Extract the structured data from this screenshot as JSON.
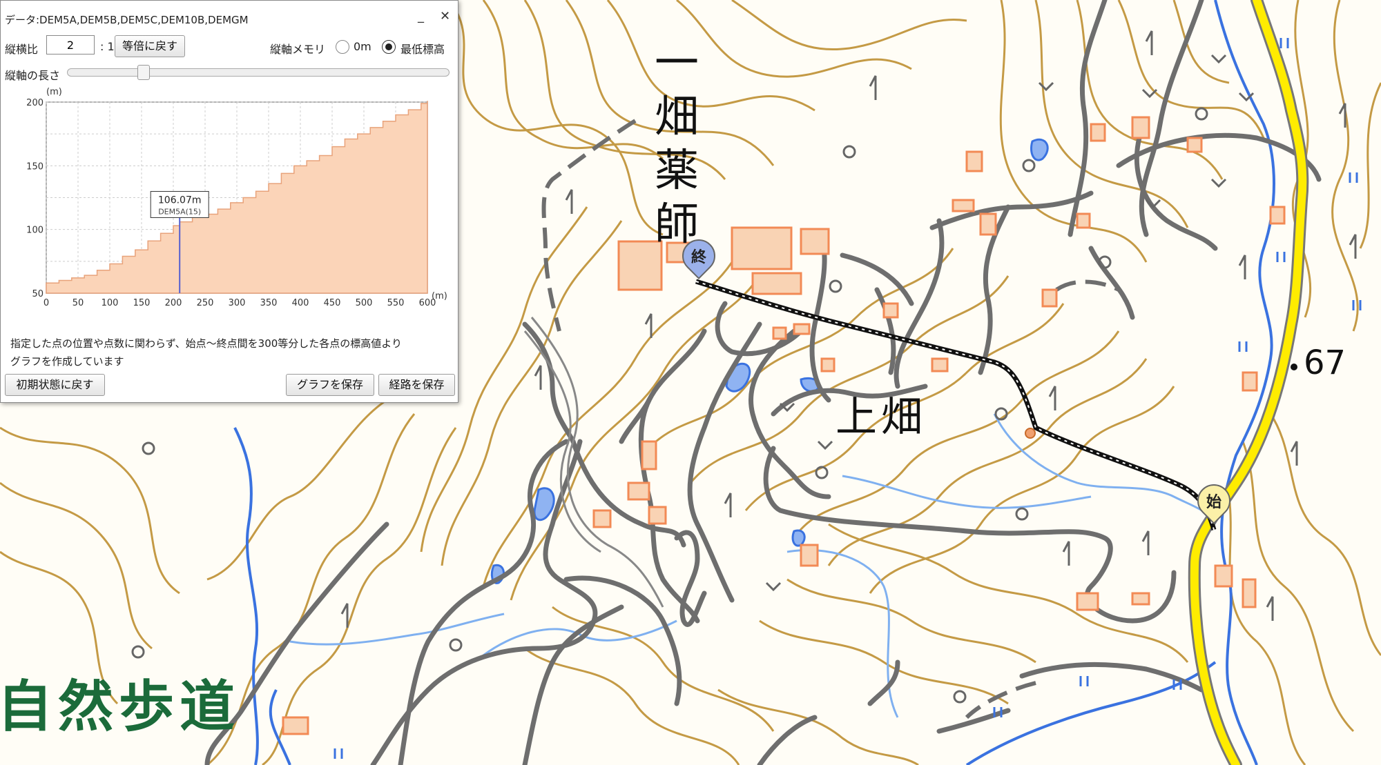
{
  "map": {
    "labels": {
      "ichihata_yakushi": [
        "一",
        "畑",
        "薬",
        "師"
      ],
      "kamihata": "上畑",
      "route_number": "67",
      "nature_trail": "自然歩道"
    },
    "markers": {
      "end": "終",
      "start": "始"
    },
    "colors": {
      "contour": "#c49a45",
      "road": "#6e6e6e",
      "river": "#3a72e0",
      "route_highlight": "#ffec00",
      "building": "#f28a55",
      "profile_path": "#111111"
    }
  },
  "panel": {
    "title": "データ:DEM5A,DEM5B,DEM5C,DEM10B,DEMGM",
    "minimize": "_",
    "close": "✕",
    "aspect_label": "縦横比",
    "aspect_value": "2",
    "aspect_suffix": ": 1",
    "reset_ratio_button": "等倍に戻す",
    "memory_label": "縦軸メモリ",
    "memory_options": [
      "0m",
      "最低標高"
    ],
    "memory_selected": "最低標高",
    "axis_length_label": "縦軸の長さ",
    "axis_length_level": 0.19,
    "note_line1": "指定した点の位置や点数に関わらず、始点～終点間を300等分した各点の標高値より",
    "note_line2": "グラフを作成しています",
    "reset_button": "初期状態に戻す",
    "save_graph_button": "グラフを保存",
    "save_route_button": "経路を保存"
  },
  "chart_data": {
    "type": "area",
    "ylabel": "(m)",
    "xlabel": "(m)",
    "xlim": [
      0,
      600
    ],
    "ylim": [
      50,
      200
    ],
    "x_ticks": [
      0,
      50,
      100,
      150,
      200,
      250,
      300,
      350,
      400,
      450,
      500,
      550,
      600
    ],
    "y_ticks": [
      50,
      100,
      150,
      200
    ],
    "grid": true,
    "x": [
      0,
      20,
      40,
      60,
      80,
      100,
      120,
      140,
      160,
      180,
      200,
      210,
      230,
      250,
      270,
      290,
      310,
      330,
      350,
      370,
      390,
      410,
      430,
      450,
      470,
      490,
      510,
      530,
      550,
      570,
      590,
      600
    ],
    "y": [
      58,
      60,
      62,
      64,
      68,
      73,
      79,
      84,
      91,
      97,
      103,
      106,
      110,
      112,
      116,
      121,
      125,
      130,
      136,
      144,
      150,
      154,
      158,
      165,
      171,
      175,
      180,
      185,
      190,
      194,
      199,
      201
    ],
    "cursor": {
      "x": 210,
      "y": 106.07,
      "value_label": "106.07m",
      "source_label": "DEM5A(15)"
    }
  }
}
